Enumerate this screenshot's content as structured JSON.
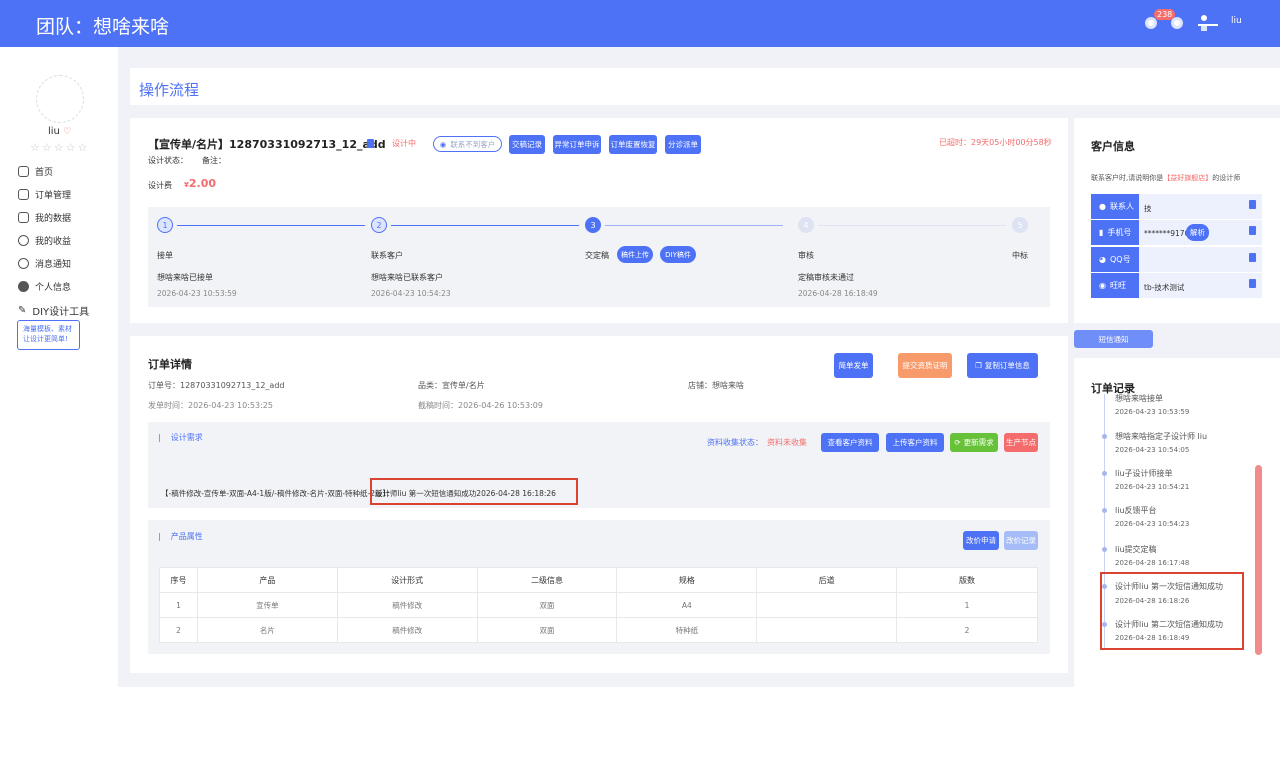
{
  "header": {
    "title": "团队：想啥来啥",
    "badge": "238",
    "user": "liu"
  },
  "sidebar": {
    "username": "liu",
    "stars": "☆☆☆☆☆",
    "items": [
      {
        "label": "首页"
      },
      {
        "label": "订单管理"
      },
      {
        "label": "我的数据"
      },
      {
        "label": "我的收益"
      },
      {
        "label": "消息通知"
      },
      {
        "label": "个人信息"
      },
      {
        "label": "DIY设计工具"
      }
    ],
    "tip": "海量模板、素材让设计更简单!"
  },
  "page": {
    "title": "操作流程"
  },
  "order": {
    "heading": "【宣传单/名片】",
    "order_no": "12870331092713_12_add",
    "status": "设计中",
    "contact_btn": "联系不到客户",
    "buttons": [
      "交稿记录",
      "异常订单申诉",
      "订单废置恢复",
      "分诊派单"
    ],
    "overdue": "已超时：29天05小时00分58秒",
    "design_status_label": "设计状态：",
    "remark_label": "备注：",
    "fee_label": "设计费",
    "fee_value": "2.00"
  },
  "steps": [
    {
      "num": "1",
      "name": "接单",
      "desc": "想啥来啥已接单",
      "time": "2026-04-23 10:53:59"
    },
    {
      "num": "2",
      "name": "联系客户",
      "desc": "想啥来啥已联系客户",
      "time": "2026-04-23 10:54:23"
    },
    {
      "num": "3",
      "name": "交定稿",
      "pill1": "稿件上传",
      "pill2": "DIY稿件"
    },
    {
      "num": "4",
      "name": "审核",
      "desc": "定稿审核未通过",
      "time": "2026-04-28 16:18:49"
    },
    {
      "num": "5",
      "name": "中标"
    }
  ],
  "detail": {
    "title": "订单详情",
    "btn_simple": "简单发单",
    "btn_invoice": "提交资质证明",
    "btn_copy": "复制订单信息",
    "order_no": "订单号：12870331092713_12_add",
    "category": "品类：宣传单/名片",
    "shop": "店铺：想啥来啥",
    "post_time": "发单时间：2026-04-23 10:53:25",
    "deadline": "截稿时间：2026-04-26 10:53:09"
  },
  "design_req": {
    "title": "设计需求",
    "status_label": "资料收集状态：",
    "status_value": "资料未收集",
    "btns": [
      "查看客户资料",
      "上传客户资料",
      "更新需求",
      "生产节点"
    ],
    "content": "【-稿件修改-宣传单-双面-A4-1版/-稿件修改-名片-双面-特种纸-2版】：",
    "highlight": "设计师liu 第一次短信通知成功2026-04-28 16:18:26"
  },
  "product": {
    "title": "产品属性",
    "btn1": "改价申请",
    "btn2": "改价记录",
    "columns": [
      "序号",
      "产品",
      "设计形式",
      "二级信息",
      "规格",
      "后道",
      "版数"
    ],
    "rows": [
      [
        "1",
        "宣传单",
        "稿件修改",
        "双面",
        "A4",
        "",
        "1"
      ],
      [
        "2",
        "名片",
        "稿件修改",
        "双面",
        "特种纸",
        "",
        "2"
      ]
    ]
  },
  "customer": {
    "title": "客户信息",
    "note": "联系客户时,请说明你是",
    "shop": "【益好旗舰店】",
    "note2": "的设计师",
    "rows": [
      {
        "label": "联系人",
        "value": "技"
      },
      {
        "label": "手机号",
        "value": "*******9170",
        "btn": "解析"
      },
      {
        "label": "QQ号",
        "value": ""
      },
      {
        "label": "旺旺",
        "value": "tb-技术测试"
      }
    ],
    "sms_btn": "短信通知"
  },
  "records": {
    "title": "订单记录",
    "items": [
      {
        "text": "想啥来啥接单",
        "time": "2026-04-23 10:53:59"
      },
      {
        "text": "想啥来啥指定子设计师 liu",
        "time": "2026-04-23 10:54:05"
      },
      {
        "text": "liu子设计师接单",
        "time": "2026-04-23 10:54:21"
      },
      {
        "text": "liu反馈平台",
        "time": "2026-04-23 10:54:23"
      },
      {
        "text": "liu提交定稿",
        "time": "2026-04-28 16:17:48"
      },
      {
        "text": "设计师liu 第一次短信通知成功",
        "time": "2026-04-28 16:18:26"
      },
      {
        "text": "设计师liu 第二次短信通知成功",
        "time": "2026-04-28 16:18:49"
      }
    ]
  },
  "colors": {
    "primary": "#4d72f6",
    "danger": "#f56c6c",
    "highlight_border": "#d9432f"
  }
}
